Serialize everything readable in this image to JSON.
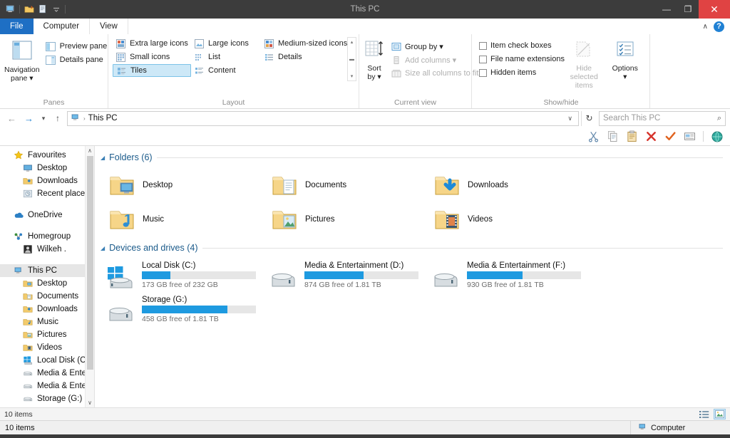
{
  "window": {
    "title": "This PC",
    "quick_access": [
      {
        "name": "this-pc-icon",
        "glyph": "🖥"
      },
      {
        "name": "new-folder-icon",
        "glyph": "📁"
      },
      {
        "name": "properties-icon",
        "glyph": "📄"
      },
      {
        "name": "customize-qat-icon",
        "glyph": "▾"
      }
    ],
    "controls": {
      "minimize": "—",
      "maximize": "❐",
      "close": "✕"
    }
  },
  "ribbon": {
    "tabs": [
      {
        "label": "File",
        "type": "file"
      },
      {
        "label": "Computer",
        "type": "normal"
      },
      {
        "label": "View",
        "type": "active"
      }
    ],
    "collapse_caret": "∧",
    "help_label": "?",
    "groups": {
      "panes": {
        "label": "Panes",
        "navigation_pane": {
          "line1": "Navigation",
          "line2": "pane ▾"
        },
        "items": [
          {
            "label": "Preview pane",
            "icon": "preview-pane-icon",
            "state": "enabled"
          },
          {
            "label": "Details pane",
            "icon": "details-pane-icon",
            "state": "enabled"
          }
        ]
      },
      "layout": {
        "label": "Layout",
        "items": [
          {
            "label": "Extra large icons",
            "selected": false
          },
          {
            "label": "Small icons",
            "selected": false
          },
          {
            "label": "Tiles",
            "selected": true
          },
          {
            "label": "Large icons",
            "selected": false
          },
          {
            "label": "List",
            "selected": false
          },
          {
            "label": "Content",
            "selected": false
          },
          {
            "label": "Medium-sized icons",
            "selected": false
          },
          {
            "label": "Details",
            "selected": false
          }
        ],
        "scroll": {
          "up": "▴",
          "down": "▾",
          "more": "▬"
        }
      },
      "current_view": {
        "label": "Current view",
        "sort_by": {
          "line1": "Sort",
          "line2": "by ▾"
        },
        "items": [
          {
            "label": "Group by ▾",
            "state": "enabled"
          },
          {
            "label": "Add columns ▾",
            "state": "disabled"
          },
          {
            "label": "Size all columns to fit",
            "state": "disabled"
          }
        ]
      },
      "show_hide": {
        "label": "Show/hide",
        "checkboxes": [
          {
            "label": "Item check boxes",
            "checked": false
          },
          {
            "label": "File name extensions",
            "checked": false
          },
          {
            "label": "Hidden items",
            "checked": false
          }
        ],
        "hide_selected": {
          "line1": "Hide selected",
          "line2": "items",
          "state": "disabled"
        },
        "options": {
          "line1": "Options",
          "line2": "▾"
        }
      }
    }
  },
  "address_bar": {
    "back": "←",
    "forward": "→",
    "recent_dropdown": "▾",
    "up": "↑",
    "path_icon": "this-pc-icon",
    "path_separator": "›",
    "path_text": "This PC",
    "path_dropdown": "∨",
    "refresh": "↻",
    "search_placeholder": "Search This PC",
    "search_value": "",
    "search_glyph": "⌕"
  },
  "command_strip": {
    "icons": [
      {
        "name": "cut-icon",
        "glyph": "✂"
      },
      {
        "name": "copy-icon",
        "glyph": "⧉"
      },
      {
        "name": "paste-icon",
        "glyph": "📋"
      },
      {
        "name": "delete-icon",
        "glyph": "✕"
      },
      {
        "name": "confirm-icon",
        "glyph": "✔"
      },
      {
        "name": "rename-icon",
        "glyph": "▭"
      },
      {
        "name": "network-icon",
        "glyph": "●"
      }
    ]
  },
  "sidebar": {
    "groups": [
      {
        "header": {
          "label": "Favourites",
          "icon": "star-icon",
          "level": 0
        },
        "items": [
          {
            "label": "Desktop",
            "icon": "desktop-icon",
            "level": 1
          },
          {
            "label": "Downloads",
            "icon": "downloads-folder-icon",
            "level": 1
          },
          {
            "label": "Recent places",
            "icon": "recent-places-icon",
            "level": 1
          }
        ]
      },
      {
        "header": {
          "label": "OneDrive",
          "icon": "onedrive-icon",
          "level": 0
        },
        "items": []
      },
      {
        "header": {
          "label": "Homegroup",
          "icon": "homegroup-icon",
          "level": 0
        },
        "items": [
          {
            "label": "Wilkeh .",
            "icon": "user-icon",
            "level": 1
          }
        ]
      },
      {
        "header": {
          "label": "This PC",
          "icon": "this-pc-icon",
          "level": 0,
          "selected": true
        },
        "items": [
          {
            "label": "Desktop",
            "icon": "desktop-folder-icon",
            "level": 1
          },
          {
            "label": "Documents",
            "icon": "documents-folder-icon",
            "level": 1
          },
          {
            "label": "Downloads",
            "icon": "downloads-folder-icon",
            "level": 1
          },
          {
            "label": "Music",
            "icon": "music-folder-icon",
            "level": 1
          },
          {
            "label": "Pictures",
            "icon": "pictures-folder-icon",
            "level": 1
          },
          {
            "label": "Videos",
            "icon": "videos-folder-icon",
            "level": 1
          },
          {
            "label": "Local Disk (C:)",
            "icon": "windows-drive-icon",
            "level": 1
          },
          {
            "label": "Media & Entertai",
            "icon": "drive-icon",
            "level": 1
          },
          {
            "label": "Media & Entertai",
            "icon": "drive-icon",
            "level": 1
          },
          {
            "label": "Storage (G:)",
            "icon": "drive-icon",
            "level": 1
          }
        ]
      }
    ],
    "scroll_up": "∧",
    "scroll_down": "∨"
  },
  "content": {
    "folders_group": {
      "title": "Folders (6)",
      "collapse_glyph": "◢",
      "items": [
        {
          "label": "Desktop",
          "icon": "desktop-folder-icon"
        },
        {
          "label": "Documents",
          "icon": "documents-folder-icon"
        },
        {
          "label": "Downloads",
          "icon": "downloads-folder-icon"
        },
        {
          "label": "Music",
          "icon": "music-folder-icon"
        },
        {
          "label": "Pictures",
          "icon": "pictures-folder-icon"
        },
        {
          "label": "Videos",
          "icon": "videos-folder-icon"
        }
      ]
    },
    "drives_group": {
      "title": "Devices and drives (4)",
      "collapse_glyph": "◢",
      "items": [
        {
          "label": "Local Disk (C:)",
          "free_text": "173 GB free of 232 GB",
          "used_percent": 25,
          "icon": "windows-drive-icon"
        },
        {
          "label": "Media & Entertainment (D:)",
          "free_text": "874 GB free of 1.81 TB",
          "used_percent": 52,
          "icon": "drive-icon"
        },
        {
          "label": "Media & Entertainment (F:)",
          "free_text": "930 GB free of 1.81 TB",
          "used_percent": 49,
          "icon": "drive-icon"
        },
        {
          "label": "Storage (G:)",
          "free_text": "458 GB free of 1.81 TB",
          "used_percent": 75,
          "icon": "drive-icon"
        }
      ]
    }
  },
  "details_bar": {
    "item_count": "10 items",
    "view_buttons": [
      {
        "name": "details-view-button",
        "glyph": "☷",
        "active": false
      },
      {
        "name": "large-icons-view-button",
        "glyph": "▣",
        "active": true
      }
    ]
  },
  "status_bar": {
    "left_text": "10 items",
    "right_text": "Computer",
    "right_icon": "this-pc-icon"
  },
  "colors": {
    "accent_blue": "#1e9ae0",
    "file_tab_blue": "#1e6fc4",
    "group_header_blue": "#1a5a8a",
    "close_red": "#e04343",
    "titlebar_gray": "#3c3c3c"
  }
}
